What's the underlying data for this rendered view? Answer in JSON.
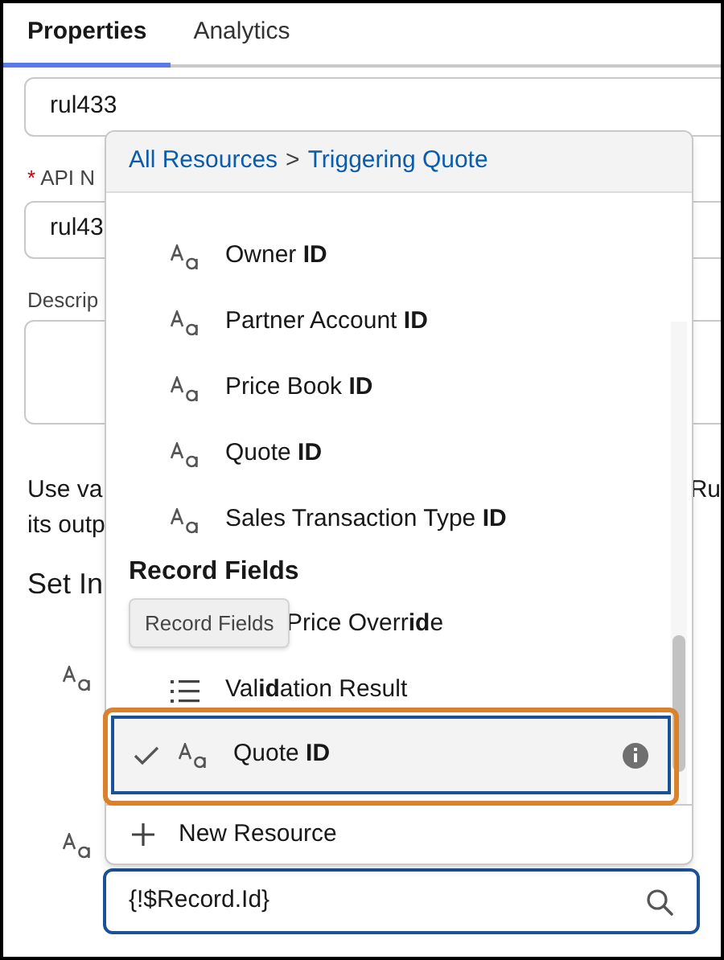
{
  "tabs": [
    {
      "label": "Properties",
      "selected": true
    },
    {
      "label": "Analytics",
      "selected": false
    }
  ],
  "form": {
    "label_field_value": "rul433",
    "api_name": {
      "label": "API N",
      "required": true,
      "required_marker": "*",
      "value": "rul43"
    },
    "description": {
      "label": "Descrip"
    },
    "help_text": {
      "line_1": "Use va",
      "line_1_end": "Ru",
      "line_2": "its outp"
    },
    "section_heading": "Set In"
  },
  "resource_search": {
    "value": "{!$Record.Id}"
  },
  "dropdown": {
    "breadcrumb": [
      {
        "label": "All Resources"
      },
      {
        "label": "Triggering Quote"
      }
    ],
    "separator": ">",
    "items": [
      {
        "kind": "text_field",
        "label": "Owner **ID**",
        "selected": false
      },
      {
        "kind": "text_field",
        "label": "Partner Account **ID**",
        "selected": false
      },
      {
        "kind": "text_field",
        "label": "Price Book **ID**",
        "selected": false
      },
      {
        "kind": "text_field",
        "label": "Quote **ID**",
        "selected": false
      },
      {
        "kind": "text_field",
        "label": "Sales Transaction Type **ID**",
        "selected": false
      },
      {
        "kind": "group_heading",
        "label": "Record Fields"
      },
      {
        "kind": "text_field",
        "label": "Price Overr**id**e",
        "tooltip": "Record Fields",
        "selected": false
      },
      {
        "kind": "list_field",
        "label": "Val**id**ation Result",
        "selected": false
      },
      {
        "kind": "text_field",
        "label": "Quote **ID**",
        "selected": true
      }
    ],
    "new_resource": "New Resource"
  }
}
